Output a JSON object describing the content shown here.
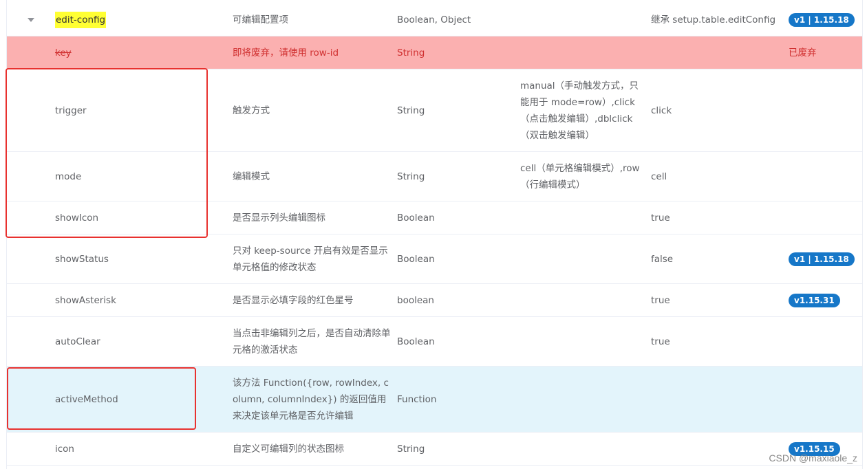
{
  "rows": [
    {
      "name": "edit-config",
      "desc": "可编辑配置项",
      "type": "Boolean, Object",
      "values": "",
      "default": "继承 setup.table.editConfig",
      "version": "v1 | 1.15.18"
    },
    {
      "name": "key",
      "desc": "即将废弃，请使用 row-id",
      "type": "String",
      "values": "",
      "default": "",
      "version": "已废弃"
    },
    {
      "name": "trigger",
      "desc": "触发方式",
      "type": "String",
      "values": "manual（手动触发方式，只能用于 mode=row）,click（点击触发编辑）,dblclick（双击触发编辑）",
      "default": "click",
      "version": ""
    },
    {
      "name": "mode",
      "desc": "编辑模式",
      "type": "String",
      "values": "cell（单元格编辑模式）,row（行编辑模式）",
      "default": "cell",
      "version": ""
    },
    {
      "name": "showIcon",
      "desc": "是否显示列头编辑图标",
      "type": "Boolean",
      "values": "",
      "default": "true",
      "version": ""
    },
    {
      "name": "showStatus",
      "desc": "只对 keep-source 开启有效是否显示单元格值的修改状态",
      "type": "Boolean",
      "values": "",
      "default": "false",
      "version": "v1 | 1.15.18"
    },
    {
      "name": "showAsterisk",
      "desc": "是否显示必填字段的红色星号",
      "type": "boolean",
      "values": "",
      "default": "true",
      "version": "v1.15.31"
    },
    {
      "name": "autoClear",
      "desc": "当点击非编辑列之后，是否自动清除单元格的激活状态",
      "type": "Boolean",
      "values": "",
      "default": "true",
      "version": ""
    },
    {
      "name": "activeMethod",
      "desc": "该方法 Function({row, rowIndex, column, columnIndex}) 的返回值用来决定该单元格是否允许编辑",
      "type": "Function",
      "values": "",
      "default": "",
      "version": ""
    },
    {
      "name": "icon",
      "desc": "自定义可编辑列的状态图标",
      "type": "String",
      "values": "",
      "default": "",
      "version": "v1.15.15"
    }
  ],
  "watermark": "CSDN @maxiaole_z",
  "colors": {
    "badge": "#1677c8",
    "deprecated_bg": "#fbb0b0",
    "deprecated_text": "#d03030",
    "highlight_bg": "#e3f4fb",
    "annotation": "#e8312f",
    "name_highlight": "#ffff33"
  }
}
